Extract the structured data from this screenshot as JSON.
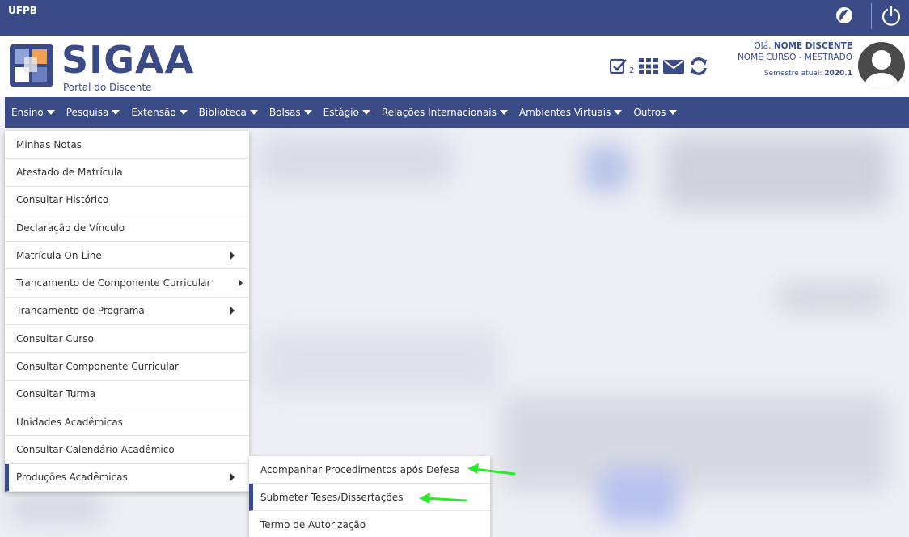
{
  "topbar": {
    "brand": "UFPB",
    "contrast_icon": "contrast-icon",
    "power_icon": "power-icon"
  },
  "header": {
    "logo_text": "SIGAA",
    "portal_subtitle": "Portal do Discente",
    "icons": [
      "check-icon",
      "grid-icon",
      "mail-icon",
      "refresh-icon"
    ],
    "check_count": "2",
    "greeting": "Olá,",
    "student_name": "NOME DISCENTE",
    "course": "NOME CURSO - MESTRADO",
    "semester_label": "Semestre atual:",
    "semester_value": "2020.1"
  },
  "nav": {
    "items": [
      {
        "label": "Ensino"
      },
      {
        "label": "Pesquisa"
      },
      {
        "label": "Extensão"
      },
      {
        "label": "Biblioteca"
      },
      {
        "label": "Bolsas"
      },
      {
        "label": "Estágio"
      },
      {
        "label": "Relações Internacionais"
      },
      {
        "label": "Ambientes Virtuais"
      },
      {
        "label": "Outros"
      }
    ]
  },
  "menu": {
    "items": [
      {
        "label": "Minhas Notas",
        "has_submenu": false
      },
      {
        "label": "Atestado de Matrícula",
        "has_submenu": false
      },
      {
        "label": "Consultar Histórico",
        "has_submenu": false
      },
      {
        "label": "Declaração de Vínculo",
        "has_submenu": false
      },
      {
        "label": "Matrícula On-Line",
        "has_submenu": true
      },
      {
        "label": "Trancamento de Componente Curricular",
        "has_submenu": true
      },
      {
        "label": "Trancamento de Programa",
        "has_submenu": true
      },
      {
        "label": "Consultar Curso",
        "has_submenu": false
      },
      {
        "label": "Consultar Componente Curricular",
        "has_submenu": false
      },
      {
        "label": "Consultar Turma",
        "has_submenu": false
      },
      {
        "label": "Unidades Acadêmicas",
        "has_submenu": false
      },
      {
        "label": "Consultar Calendário Acadêmico",
        "has_submenu": false
      },
      {
        "label": "Produções Acadêmicas",
        "has_submenu": true
      }
    ]
  },
  "submenu": {
    "items": [
      {
        "label": "Acompanhar Procedimentos após Defesa"
      },
      {
        "label": "Submeter Teses/Dissertações"
      },
      {
        "label": "Termo de Autorização"
      }
    ]
  },
  "colors": {
    "primary": "#3a4b87",
    "annotation_arrow": "#2ee82e"
  }
}
